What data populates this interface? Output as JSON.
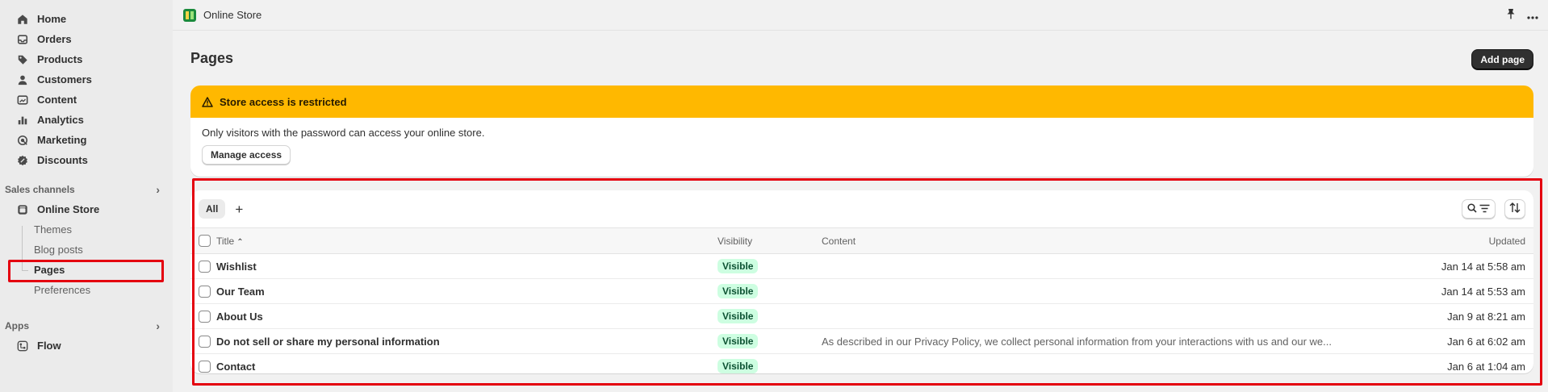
{
  "sidebar": {
    "items": [
      {
        "label": "Home",
        "icon": "home-icon"
      },
      {
        "label": "Orders",
        "icon": "inbox-icon"
      },
      {
        "label": "Products",
        "icon": "tag-icon"
      },
      {
        "label": "Customers",
        "icon": "person-icon"
      },
      {
        "label": "Content",
        "icon": "image-icon"
      },
      {
        "label": "Analytics",
        "icon": "bar-chart-icon"
      },
      {
        "label": "Marketing",
        "icon": "target-icon"
      },
      {
        "label": "Discounts",
        "icon": "discount-icon"
      }
    ],
    "sales_channels_label": "Sales channels",
    "online_store_label": "Online Store",
    "sub_items": [
      {
        "label": "Themes"
      },
      {
        "label": "Blog posts"
      },
      {
        "label": "Pages"
      },
      {
        "label": "Preferences"
      }
    ],
    "apps_label": "Apps",
    "flow_label": "Flow"
  },
  "topbar": {
    "store_name": "Online Store"
  },
  "main": {
    "title": "Pages",
    "add_button": "Add page",
    "banner": {
      "title": "Store access is restricted",
      "body": "Only visitors with the password can access your online store.",
      "button": "Manage access"
    },
    "tabs": [
      {
        "label": "All"
      }
    ],
    "table": {
      "headers": {
        "title": "Title",
        "visibility": "Visibility",
        "content": "Content",
        "updated": "Updated"
      },
      "rows": [
        {
          "title": "Wishlist",
          "visibility": "Visible",
          "content": "",
          "updated": "Jan 14 at 5:58 am"
        },
        {
          "title": "Our Team",
          "visibility": "Visible",
          "content": "",
          "updated": "Jan 14 at 5:53 am"
        },
        {
          "title": "About Us",
          "visibility": "Visible",
          "content": "",
          "updated": "Jan 9 at 8:21 am"
        },
        {
          "title": "Do not sell or share my personal information",
          "visibility": "Visible",
          "content": "As described in our Privacy Policy, we collect personal information from your interactions with us and our we...",
          "updated": "Jan 6 at 6:02 am"
        },
        {
          "title": "Contact",
          "visibility": "Visible",
          "content": "",
          "updated": "Jan 6 at 1:04 am"
        }
      ]
    }
  },
  "colors": {
    "banner_bg": "#ffb800",
    "badge_bg": "#cdfee1",
    "highlight": "#e4000f"
  }
}
